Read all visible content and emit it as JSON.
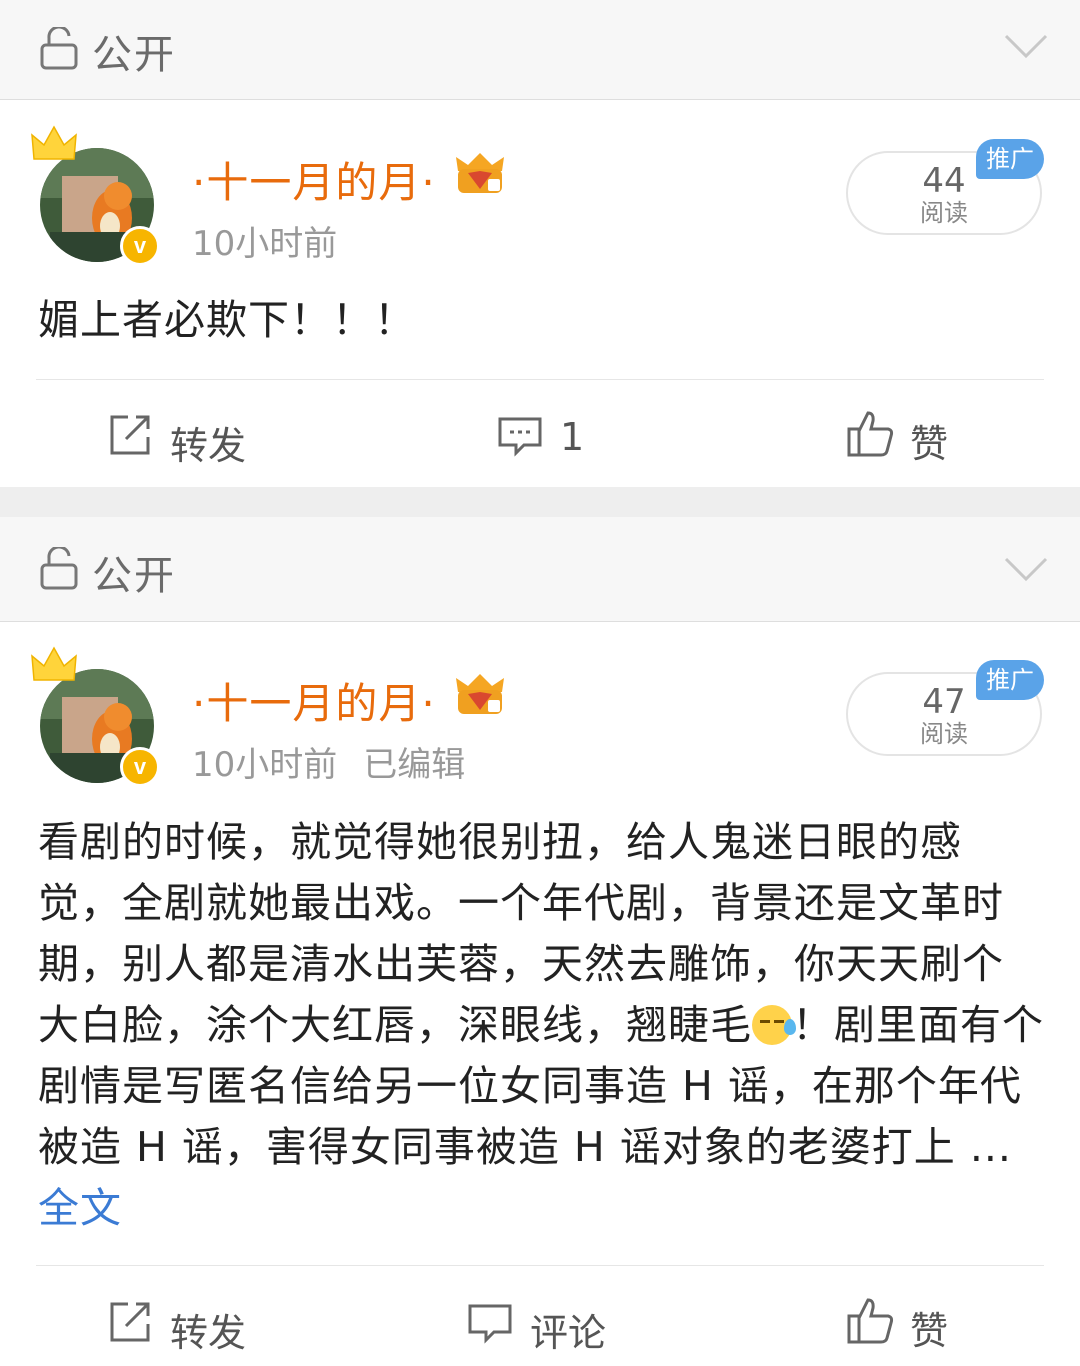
{
  "privacy_label": "公开",
  "posts": [
    {
      "username": "·十一月的月·",
      "time": "10小时前",
      "edited": "",
      "reads_count": "44",
      "reads_label": "阅读",
      "promo_badge": "推广",
      "text": "媚上者必欺下！！！",
      "actions": {
        "repost": "转发",
        "comment": "1",
        "like": "赞"
      }
    },
    {
      "username": "·十一月的月·",
      "time": "10小时前",
      "edited": "已编辑",
      "reads_count": "47",
      "reads_label": "阅读",
      "promo_badge": "推广",
      "text_before_emoji": "看剧的时候，就觉得她很别扭，给人鬼迷日眼的感觉，全剧就她最出戏。一个年代剧，背景还是文革时期，别人都是清水出芙蓉，天然去雕饰，你天天刷个大白脸，涂个大红唇，深眼线，翘睫毛",
      "text_after_emoji": "！剧里面有个剧情是写匿名信给另一位女同事造 H 谣，在那个年代被造 H 谣，害得女同事被造 H 谣对象的老婆打上 ... ",
      "full_text_link": "全文",
      "actions": {
        "repost": "转发",
        "comment": "评论",
        "like": "赞"
      }
    }
  ],
  "colors": {
    "username": "#e86b0c",
    "link": "#3b7bd4",
    "promo": "#5aa3e8",
    "verified": "#f7b500"
  },
  "icons": [
    "lock-icon",
    "chevron-down-icon",
    "crown-icon",
    "verified-icon",
    "member-icon",
    "repost-icon",
    "comment-icon",
    "like-icon",
    "sweat-emoji"
  ]
}
